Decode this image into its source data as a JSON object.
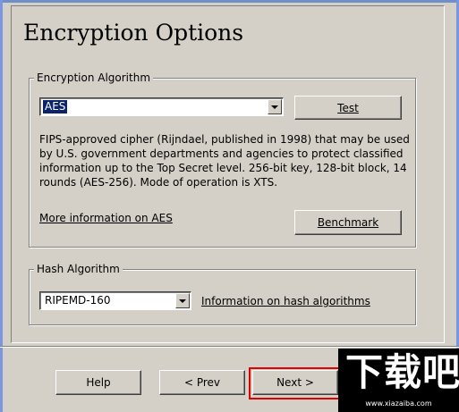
{
  "page": {
    "title": "Encryption Options"
  },
  "encryption_group": {
    "label": "Encryption Algorithm",
    "selected": "AES",
    "test_button": "Test",
    "description": "FIPS-approved cipher (Rijndael, published in 1998) that may be used by U.S. government departments and agencies to protect classified information up to the Top Secret level. 256-bit key, 128-bit block, 14 rounds (AES-256). Mode of operation is XTS.",
    "more_info_link": "More information on AES",
    "benchmark_button": "Benchmark"
  },
  "hash_group": {
    "label": "Hash Algorithm",
    "selected": "RIPEMD-160",
    "info_link": "Information on hash algorithms"
  },
  "footer": {
    "help_button": "Help",
    "prev_button": "< Prev",
    "next_button": "Next >"
  },
  "watermark": {
    "text": "下载吧",
    "url": "www.xiazaiba.com"
  },
  "colors": {
    "dialog_bg": "#d4d0c8",
    "selection": "#0a246a",
    "highlight_box": "#e00000"
  },
  "icons": {
    "combo_arrow": "chevron-down-icon"
  }
}
